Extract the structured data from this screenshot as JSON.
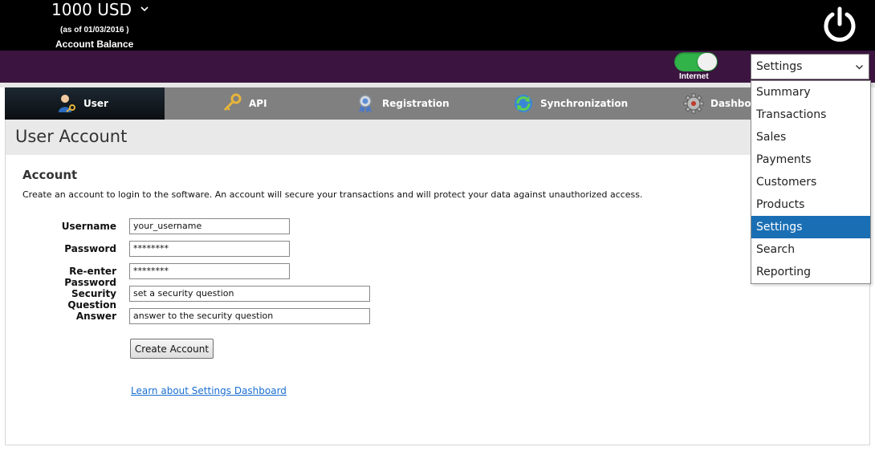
{
  "header": {
    "balance_amount": "1000 USD",
    "balance_date": "(as of 01/03/2016 )",
    "balance_label": "Account Balance"
  },
  "status": {
    "internet_label": "Internet",
    "internet_on": true
  },
  "menu_select": {
    "value": "Settings",
    "options": [
      "Summary",
      "Transactions",
      "Sales",
      "Payments",
      "Customers",
      "Products",
      "Settings",
      "Search",
      "Reporting"
    ],
    "selected_index": 6
  },
  "tabs": [
    {
      "label": "User",
      "icon": "user-key-icon",
      "active": true
    },
    {
      "label": "API",
      "icon": "key-icon",
      "active": false
    },
    {
      "label": "Registration",
      "icon": "ribbon-badge-icon",
      "active": false
    },
    {
      "label": "Synchronization",
      "icon": "sync-icon",
      "active": false
    },
    {
      "label": "Dashboard",
      "icon": "gear-icon",
      "active": false
    }
  ],
  "page": {
    "title": "User Account",
    "section_title": "Account",
    "section_desc": "Create an account to login to the software. An account will secure your transactions and will protect your data against unauthorized access."
  },
  "form": {
    "username_label": "Username",
    "username_value": "your_username",
    "password_label": "Password",
    "password_value": "********",
    "reenter_label": "Re-enter Password",
    "reenter_value": "********",
    "security_label": "Security Question",
    "security_value": "set a security question",
    "answer_label": "Answer",
    "answer_value": "answer to the security question",
    "create_button": "Create Account",
    "learn_link": "Learn about Settings Dashboard"
  },
  "colors": {
    "top_bar": "#000000",
    "purple_bar": "#3b1540",
    "toggle_on": "#31b34a",
    "tab_bar": "#808080",
    "selected_item": "#1a6fb4",
    "link": "#1a6fd1"
  }
}
